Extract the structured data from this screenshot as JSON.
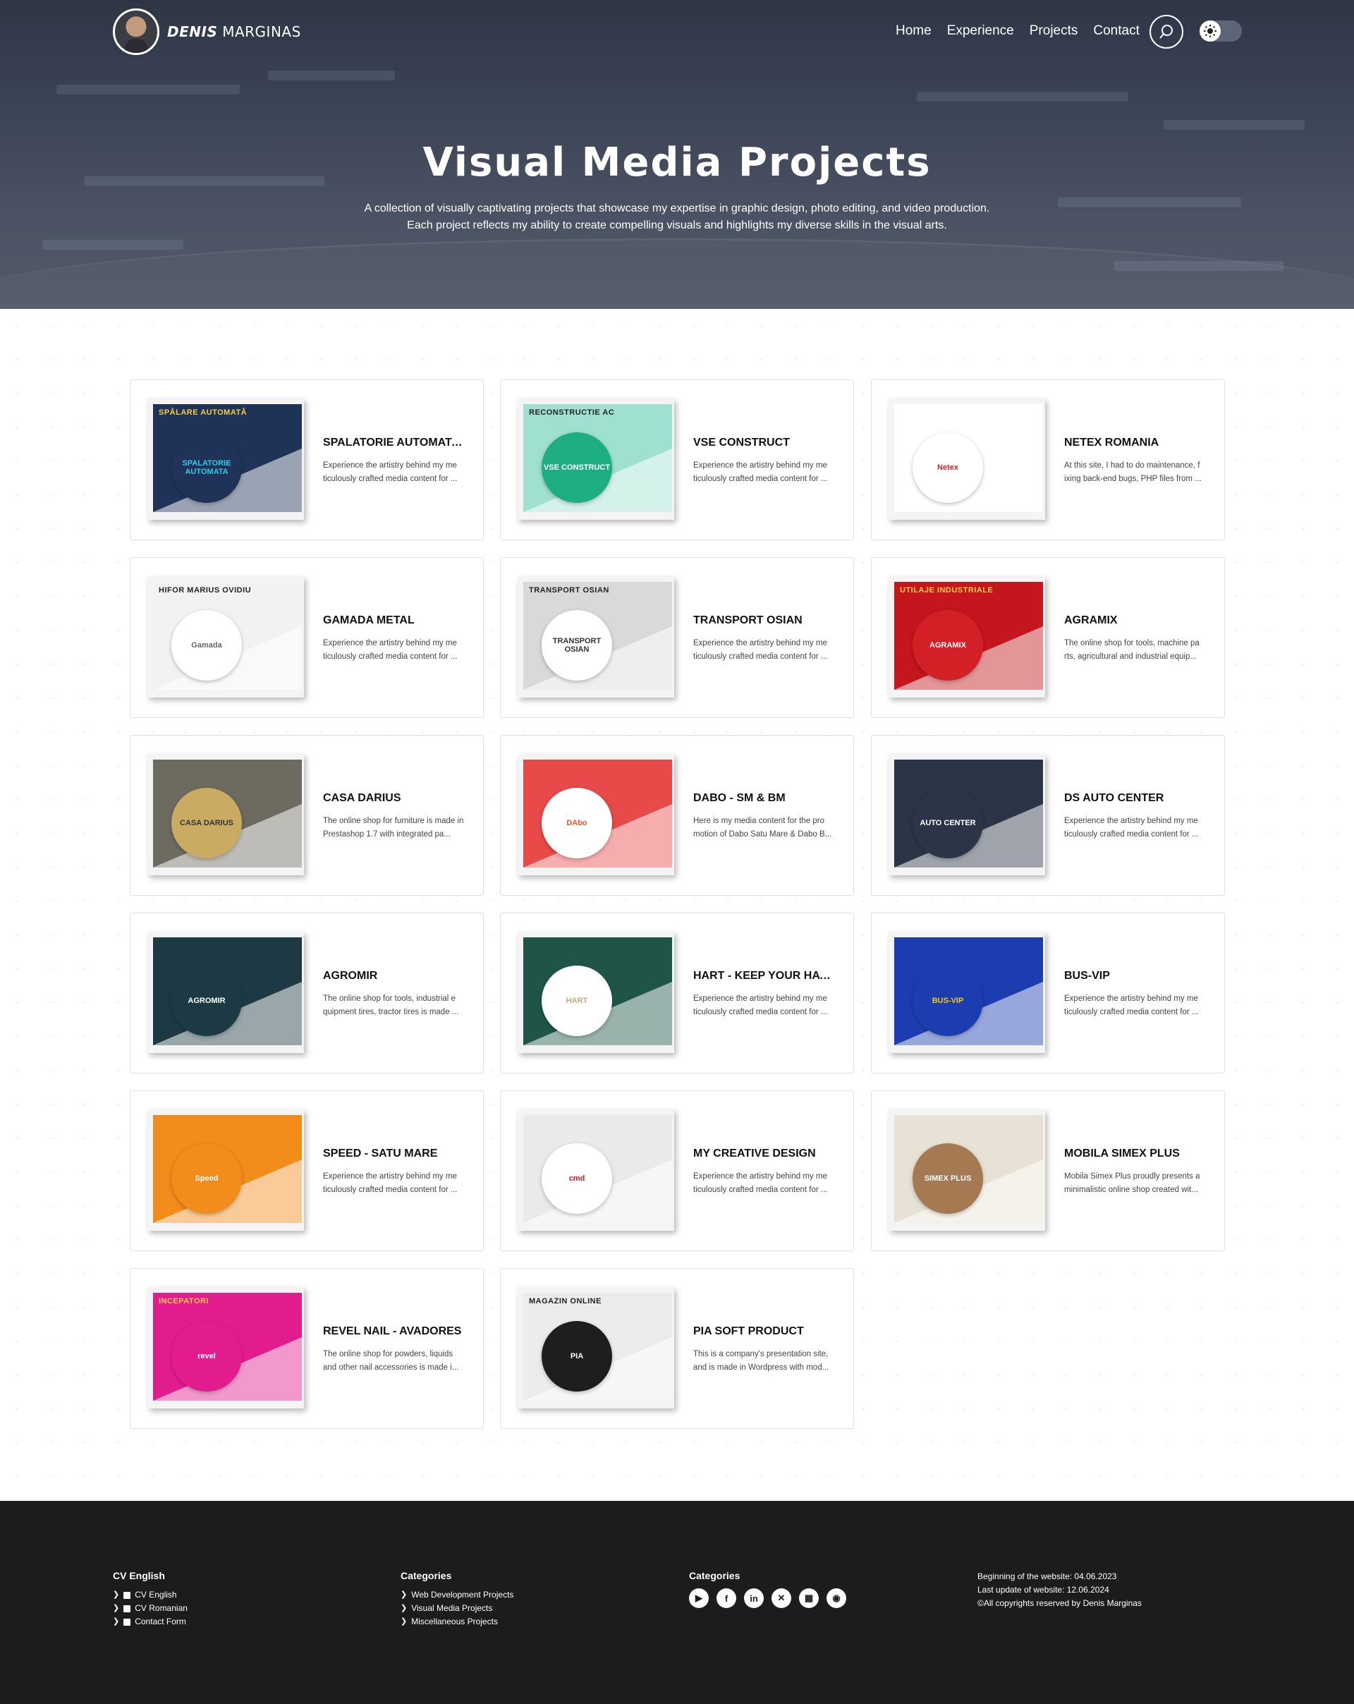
{
  "brand": {
    "name_bold": "DENIS",
    "name_rest": "MARGINAS"
  },
  "nav": {
    "home": "Home",
    "experience": "Experience",
    "projects": "Projects",
    "contact": "Contact"
  },
  "hero": {
    "title": "Visual Media Projects",
    "line1": "A collection of visually captivating projects that showcase my expertise in graphic design, photo editing, and video production.",
    "line2": "Each project reflects my ability to create compelling visuals and highlights my diverse skills in the visual arts."
  },
  "projects": [
    {
      "title": "SPALATORIE AUTOMATA...",
      "desc": "Experience the artistry behind my me ticulously crafted media content for ...",
      "thumb_text": "SPĂLARE AUTOMATĂ",
      "circle_text": "SPALATORIE AUTOMATA",
      "bg": "#1f3358",
      "circle": "#1f3358",
      "fg": "#38c8f0"
    },
    {
      "title": "VSE CONSTRUCT",
      "desc": "Experience the artistry behind my me ticulously crafted media content for ...",
      "thumb_text": "RECONSTRUCTIE AC",
      "circle_text": "VSE CONSTRUCT",
      "bg": "#9fe0d0",
      "circle": "#1fae84",
      "fg": "#ffffff"
    },
    {
      "title": "NETEX ROMANIA",
      "desc": "At this site, I had to do maintenance, f ixing back-end bugs, PHP files from ...",
      "thumb_text": "",
      "circle_text": "Netex",
      "bg": "#ffffff",
      "circle": "#ffffff",
      "fg": "#c0262c"
    },
    {
      "title": "GAMADA METAL",
      "desc": "Experience the artistry behind my me ticulously crafted media content for ...",
      "thumb_text": "HIFOR MARIUS OVIDIU",
      "circle_text": "Gamada",
      "bg": "#f2f2f2",
      "circle": "#ffffff",
      "fg": "#666666"
    },
    {
      "title": "TRANSPORT OSIAN",
      "desc": "Experience the artistry behind my me ticulously crafted media content for ...",
      "thumb_text": "TRANSPORT OSIAN",
      "circle_text": "TRANSPORT OSIAN",
      "bg": "#d9d9d9",
      "circle": "#ffffff",
      "fg": "#333333"
    },
    {
      "title": "AGRAMIX",
      "desc": "The online shop for tools, machine pa rts, agricultural and industrial equip...",
      "thumb_text": "UTILAJE INDUSTRIALE",
      "circle_text": "AGRAMIX",
      "bg": "#c4161c",
      "circle": "#d32027",
      "fg": "#ffffff"
    },
    {
      "title": "CASA DARIUS",
      "desc": "The online shop for furniture is made in Prestashop 1.7 with integrated pa...",
      "thumb_text": "",
      "circle_text": "CASA DARIUS",
      "bg": "#6d6a60",
      "circle": "#c9ac62",
      "fg": "#333333"
    },
    {
      "title": "DABO - SM & BM",
      "desc": "Here is my media content for the pro motion of Dabo Satu Mare & Dabo B...",
      "thumb_text": "",
      "circle_text": "DAbo",
      "bg": "#e84a4a",
      "circle": "#ffffff",
      "fg": "#e5592c"
    },
    {
      "title": "DS AUTO CENTER",
      "desc": "Experience the artistry behind my me ticulously crafted media content for ...",
      "thumb_text": "",
      "circle_text": "AUTO CENTER",
      "bg": "#2c3448",
      "circle": "#2c3448",
      "fg": "#ffffff"
    },
    {
      "title": "AGROMIR",
      "desc": "The online shop for tools, industrial e quipment tires, tractor tires is made ...",
      "thumb_text": "",
      "circle_text": "AGROMIR",
      "bg": "#1d3a44",
      "circle": "#1d3a44",
      "fg": "#ffffff"
    },
    {
      "title": "HART - KEEP YOUR HAT ON",
      "desc": "Experience the artistry behind my me ticulously crafted media content for ...",
      "thumb_text": "",
      "circle_text": "HART",
      "bg": "#1f5548",
      "circle": "#ffffff",
      "fg": "#c9a87a"
    },
    {
      "title": "BUS-VIP",
      "desc": "Experience the artistry behind my me ticulously crafted media content for ...",
      "thumb_text": "",
      "circle_text": "BUS-VIP",
      "bg": "#1c3db0",
      "circle": "#1c3db0",
      "fg": "#f4c90f"
    },
    {
      "title": "SPEED - SATU MARE",
      "desc": "Experience the artistry behind my me ticulously crafted media content for ...",
      "thumb_text": "",
      "circle_text": "Speed",
      "bg": "#f28c1b",
      "circle": "#f28c1b",
      "fg": "#ffffff"
    },
    {
      "title": "MY CREATIVE DESIGN",
      "desc": "Experience the artistry behind my me ticulously crafted media content for ...",
      "thumb_text": "",
      "circle_text": "cmd",
      "bg": "#eaeaea",
      "circle": "#ffffff",
      "fg": "#b81d2a"
    },
    {
      "title": "MOBILA SIMEX PLUS",
      "desc": "Mobila Simex Plus proudly presents a minimalistic online shop created wit...",
      "thumb_text": "",
      "circle_text": "SIMEX PLUS",
      "bg": "#e8e2d6",
      "circle": "#a57a52",
      "fg": "#ffffff"
    },
    {
      "title": "REVEL NAIL - AVADORES",
      "desc": "The online shop for powders, liquids and other nail accessories is made i...",
      "thumb_text": "INCEPATORI",
      "circle_text": "revel",
      "bg": "#e21c8f",
      "circle": "#e21c8f",
      "fg": "#ffffff"
    },
    {
      "title": "PIA SOFT PRODUCT",
      "desc": "This is a company's presentation site, and is made in Wordpress with mod...",
      "thumb_text": "MAGAZIN ONLINE",
      "circle_text": "PIA",
      "bg": "#ececec",
      "circle": "#1e1e1e",
      "fg": "#ffffff"
    }
  ],
  "footer": {
    "col1": {
      "title": "CV English",
      "items": [
        "CV English",
        "CV Romanian",
        "Contact Form"
      ]
    },
    "col2": {
      "title": "Categories",
      "items": [
        "Web Development Projects",
        "Visual Media Projects",
        "Miscellaneous Projects"
      ]
    },
    "col3": {
      "title": "Categories",
      "social": [
        "youtube-icon",
        "facebook-icon",
        "linkedin-icon",
        "x-icon",
        "website-icon",
        "github-icon"
      ]
    },
    "col4": {
      "start": "Beginning of the website: 04.06.2023",
      "update": "Last update of website: 12.06.2024",
      "copyright": "©All copyrights reserved by Denis Marginas"
    }
  }
}
